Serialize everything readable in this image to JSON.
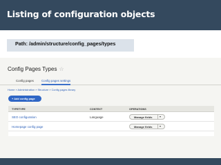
{
  "slide": {
    "title": "Listing of configuration objects",
    "path": "Path: /admin/structure/config_pages/types"
  },
  "screenshot": {
    "page_title": "Config Pages Types",
    "star_icon": "star-icon",
    "tabs": [
      {
        "label": "Config pages",
        "active": false
      },
      {
        "label": "Config pages settings",
        "active": true
      }
    ],
    "breadcrumb": "Home » Administration » Structure » Config pages library",
    "add_button_label": "+ Add config page",
    "table": {
      "headers": [
        "TYPETYPE",
        "CONTEXT",
        "OPERATIONS"
      ],
      "rows": [
        {
          "type": "SEO configuration",
          "context": "Language",
          "operation": "Manage fields",
          "toggle": "▾"
        },
        {
          "type": "Homepage config page",
          "context": "",
          "operation": "Manage fields",
          "toggle": "▾"
        }
      ]
    }
  }
}
